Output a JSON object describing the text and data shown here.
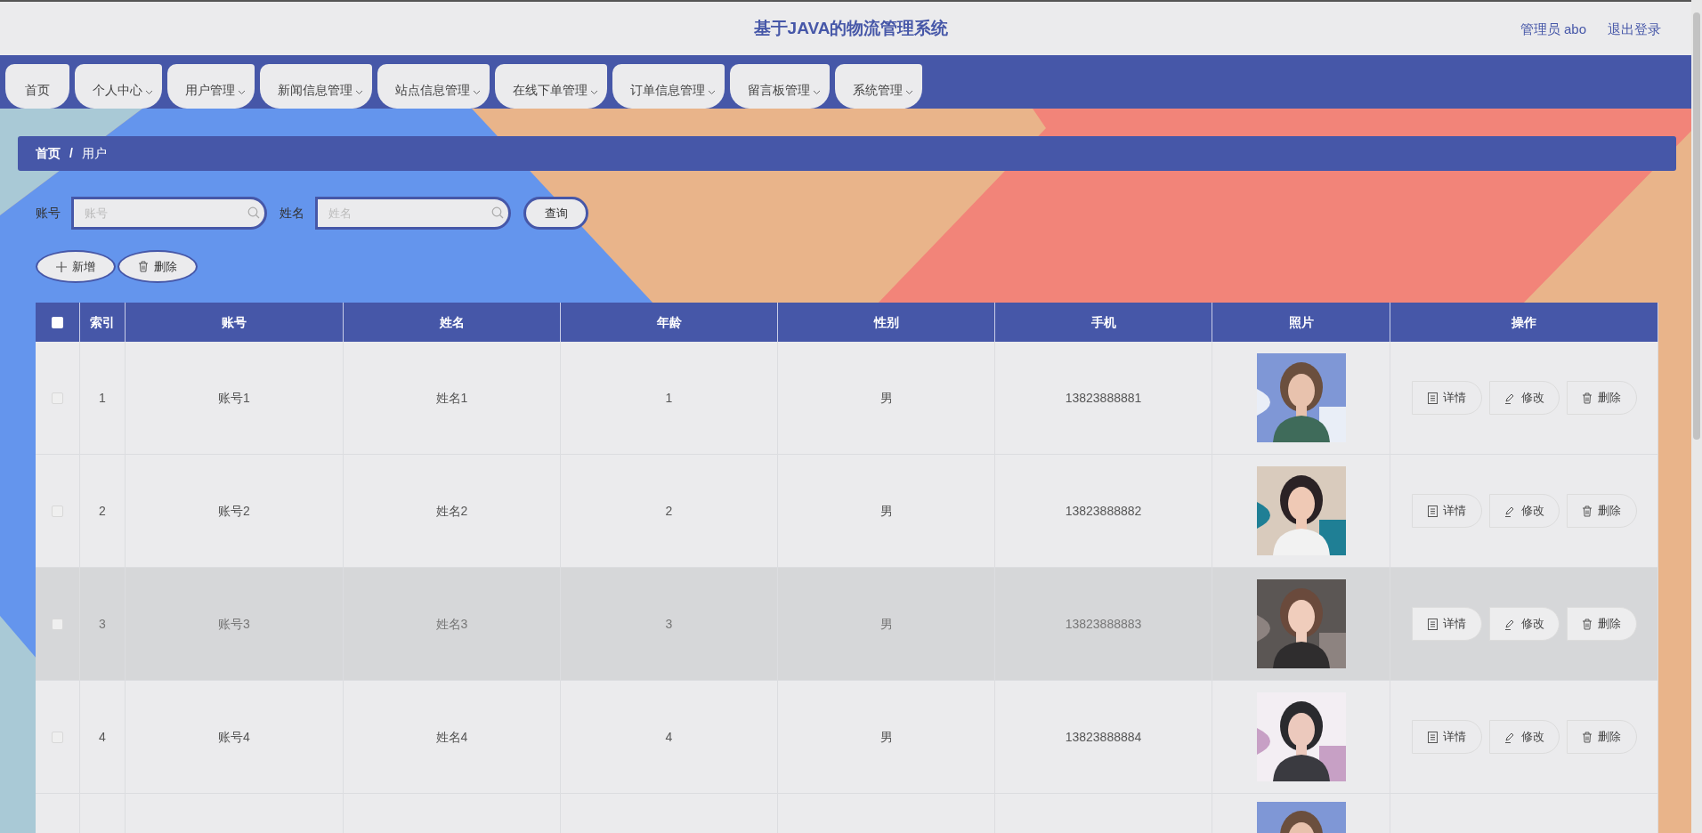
{
  "header": {
    "title": "基于JAVA的物流管理系统",
    "user_label": "管理员 abo",
    "logout": "退出登录"
  },
  "nav": [
    {
      "label": "首页",
      "dropdown": false
    },
    {
      "label": "个人中心",
      "dropdown": true
    },
    {
      "label": "用户管理",
      "dropdown": true
    },
    {
      "label": "新闻信息管理",
      "dropdown": true
    },
    {
      "label": "站点信息管理",
      "dropdown": true
    },
    {
      "label": "在线下单管理",
      "dropdown": true
    },
    {
      "label": "订单信息管理",
      "dropdown": true
    },
    {
      "label": "留言板管理",
      "dropdown": true
    },
    {
      "label": "系统管理",
      "dropdown": true
    }
  ],
  "breadcrumb": {
    "items": [
      "首页",
      "用户"
    ],
    "separator": "/"
  },
  "search": {
    "fields": [
      {
        "label": "账号",
        "placeholder": "账号"
      },
      {
        "label": "姓名",
        "placeholder": "姓名"
      }
    ],
    "button": "查询"
  },
  "actions": [
    {
      "kind": "add",
      "label": "新增"
    },
    {
      "kind": "delete",
      "label": "删除"
    }
  ],
  "table": {
    "select_all_checked": false,
    "columns": [
      "索引",
      "账号",
      "姓名",
      "年龄",
      "性别",
      "手机",
      "照片",
      "操作"
    ],
    "rows": [
      {
        "kind": "full",
        "checked": false,
        "highlighted": false,
        "cells": [
          "1",
          "账号1",
          "姓名1",
          "1",
          "男",
          "13823888881"
        ],
        "actions": [
          {
            "kind": "detail",
            "label": "详情"
          },
          {
            "kind": "edit",
            "label": "修改"
          },
          {
            "kind": "delete",
            "label": "删除"
          }
        ]
      },
      {
        "kind": "full",
        "checked": false,
        "highlighted": false,
        "cells": [
          "2",
          "账号2",
          "姓名2",
          "2",
          "男",
          "13823888882"
        ],
        "actions": [
          {
            "kind": "detail",
            "label": "详情"
          },
          {
            "kind": "edit",
            "label": "修改"
          },
          {
            "kind": "delete",
            "label": "删除"
          }
        ]
      },
      {
        "kind": "full",
        "checked": false,
        "highlighted": true,
        "cells": [
          "3",
          "账号3",
          "姓名3",
          "3",
          "男",
          "13823888883"
        ],
        "actions": [
          {
            "kind": "detail",
            "label": "详情"
          },
          {
            "kind": "edit",
            "label": "修改"
          },
          {
            "kind": "delete",
            "label": "删除"
          }
        ]
      },
      {
        "kind": "full",
        "checked": false,
        "highlighted": false,
        "cells": [
          "4",
          "账号4",
          "姓名4",
          "4",
          "男",
          "13823888884"
        ],
        "actions": [
          {
            "kind": "detail",
            "label": "详情"
          },
          {
            "kind": "edit",
            "label": "修改"
          },
          {
            "kind": "delete",
            "label": "删除"
          }
        ]
      },
      {
        "kind": "partial"
      }
    ]
  }
}
